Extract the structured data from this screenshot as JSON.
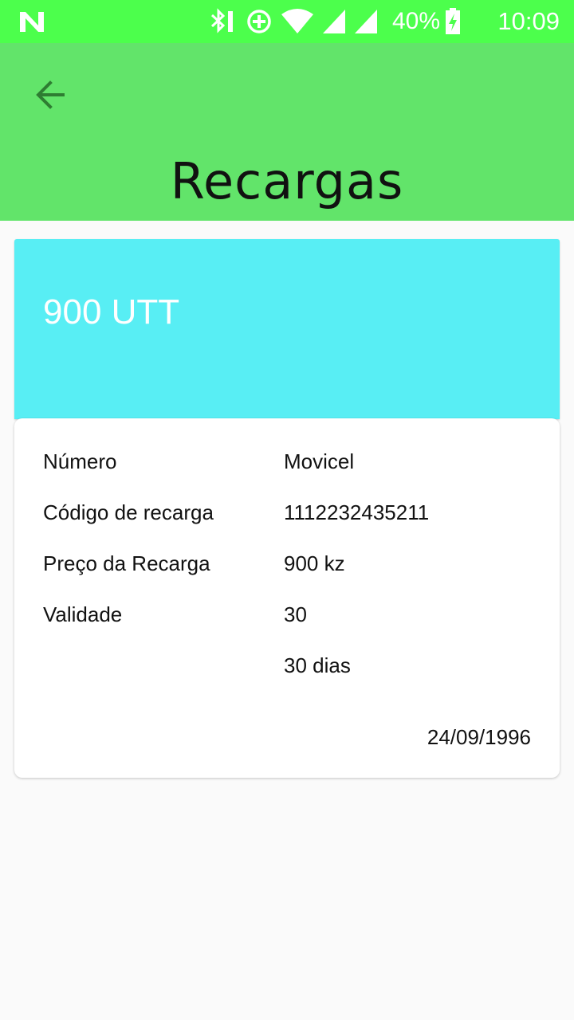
{
  "status_bar": {
    "battery_percent": "40%",
    "time": "10:09",
    "icons": [
      "n-logo-icon",
      "bluetooth-icon",
      "data-saver-icon",
      "wifi-icon",
      "signal-icon",
      "signal-icon-2",
      "battery-charging-icon"
    ]
  },
  "app_bar": {
    "title": "Recargas",
    "back_icon": "arrow-back-icon"
  },
  "card": {
    "amount": "900 UTT",
    "rows": [
      {
        "label": "Número",
        "value": "Movicel"
      },
      {
        "label": "Código de recarga",
        "value": "1112232435211"
      },
      {
        "label": "Preço da Recarga",
        "value": "900 kz"
      },
      {
        "label": "Validade",
        "value": "30"
      },
      {
        "label": "",
        "value": "30 dias"
      }
    ],
    "date": "24/09/1996"
  },
  "colors": {
    "status_bar": "#4cff4c",
    "app_bar": "#62e46a",
    "card_header": "#58eef4",
    "back_arrow": "#2e7d32",
    "background": "#fafafa"
  }
}
